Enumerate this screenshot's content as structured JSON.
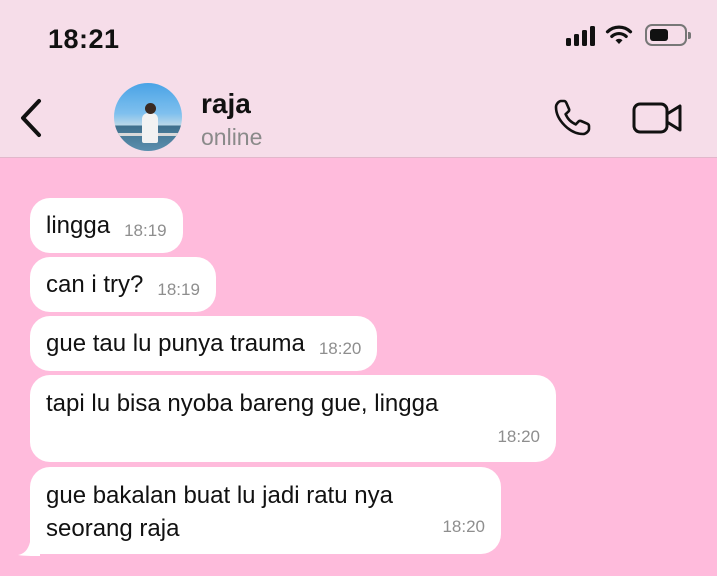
{
  "status_bar": {
    "time": "18:21",
    "icons": [
      "cellular-signal-icon",
      "wifi-icon",
      "battery-icon"
    ]
  },
  "header": {
    "back_icon": "chevron-left-icon",
    "contact_name": "raja",
    "contact_status": "online",
    "call_icon": "phone-icon",
    "video_icon": "video-camera-icon"
  },
  "colors": {
    "chat_background": "#ffbbdc",
    "header_background": "#f6dde9",
    "bubble_background": "#ffffff",
    "timestamp": "#8e8e8e",
    "status_text": "#8a8a8a"
  },
  "messages": [
    {
      "text": "lingga",
      "time": "18:19"
    },
    {
      "text": "can i try?",
      "time": "18:19"
    },
    {
      "text": "gue tau lu punya trauma",
      "time": "18:20"
    },
    {
      "text": "tapi lu bisa nyoba bareng gue, lingga",
      "time": "18:20"
    },
    {
      "lines": [
        "gue bakalan buat lu jadi ratu nya",
        "seorang raja"
      ],
      "time": "18:20"
    }
  ]
}
